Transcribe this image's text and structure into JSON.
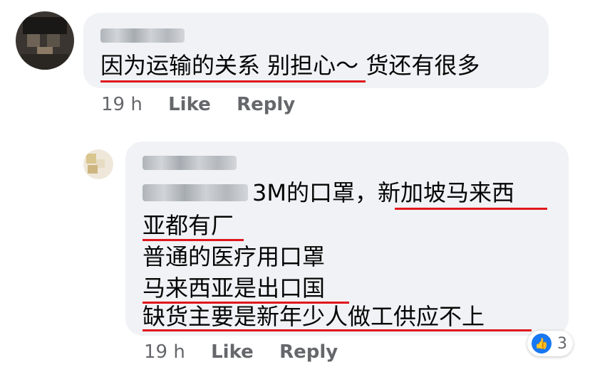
{
  "comment1": {
    "text": "因为运输的关系 别担心～ 货还有很多",
    "time": "19 h",
    "like": "Like",
    "reply": "Reply"
  },
  "comment2": {
    "line1_text": "3M的口罩，新加坡马来西",
    "line2": "亚都有厂",
    "line3": "普通的医疗用口罩",
    "line4": "马来西亚是出口国",
    "line5": "缺货主要是新年少人做工供应不上",
    "time": "19 h",
    "like": "Like",
    "reply": "Reply",
    "reaction_count": "3"
  },
  "colors": {
    "underline": "#e0161c",
    "like_blue": "#1877f2",
    "bubble": "#f0f2f5"
  },
  "icons": {
    "reaction": "thumbs-up-icon"
  }
}
